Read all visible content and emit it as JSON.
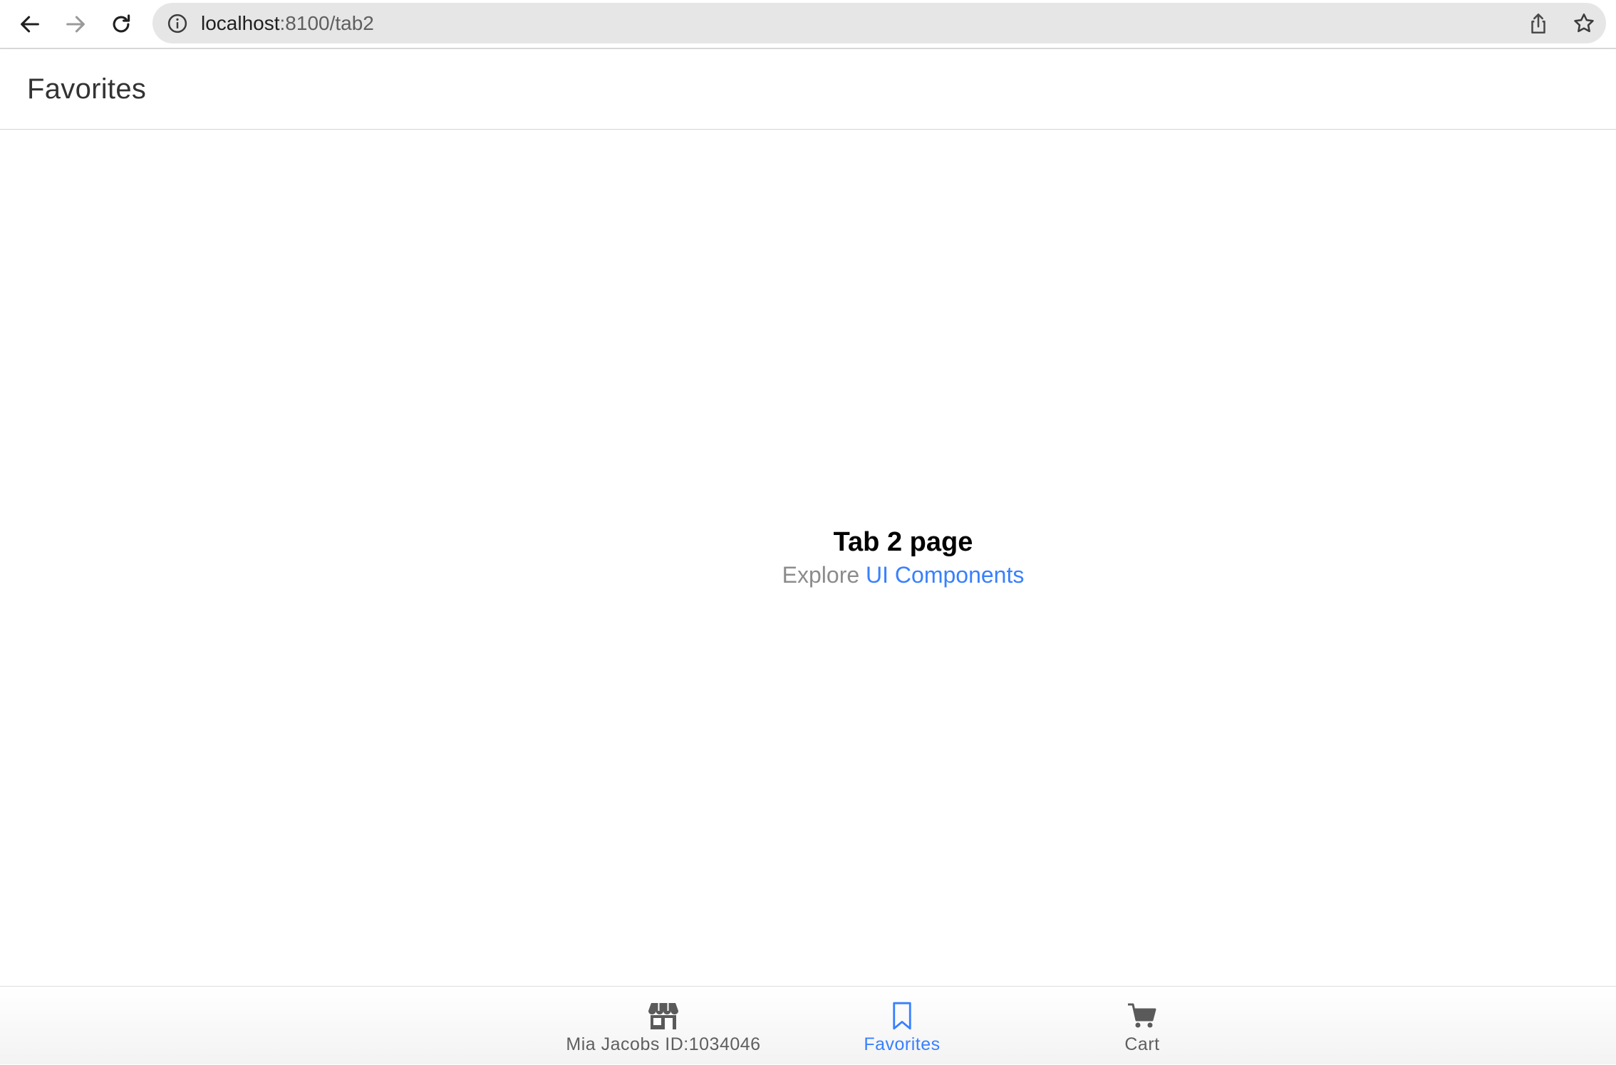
{
  "browser": {
    "url_host": "localhost",
    "url_path": ":8100/tab2"
  },
  "header": {
    "title": "Favorites"
  },
  "main": {
    "title": "Tab 2 page",
    "subtitle_prefix": "Explore",
    "subtitle_link": "UI Components"
  },
  "tabs": [
    {
      "label": "Mia Jacobs ID:1034046",
      "icon": "storefront-icon",
      "selected": false
    },
    {
      "label": "Favorites",
      "icon": "bookmark-icon",
      "selected": true
    },
    {
      "label": "Cart",
      "icon": "cart-icon",
      "selected": false
    }
  ],
  "colors": {
    "accent": "#3880ff",
    "tab_inactive": "#5f5f5f",
    "title_text": "#333333"
  }
}
